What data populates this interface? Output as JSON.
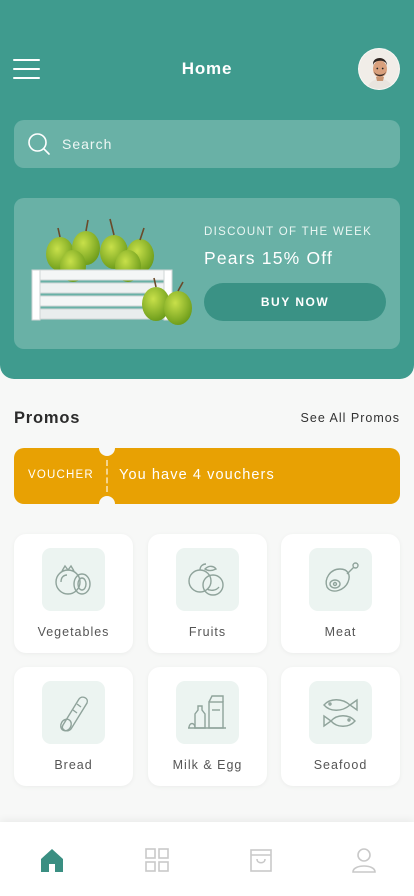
{
  "header": {
    "title": "Home"
  },
  "search": {
    "placeholder": "Search"
  },
  "promo_card": {
    "label": "DISCOUNT OF THE WEEK",
    "title": "Pears 15% Off",
    "button_label": "BUY NOW"
  },
  "promos": {
    "title": "Promos",
    "see_all_label": "See All Promos",
    "voucher_tag": "VOUCHER",
    "voucher_text": "You have 4 vouchers"
  },
  "categories": [
    {
      "label": "Vegetables",
      "icon": "vegetables-icon"
    },
    {
      "label": "Fruits",
      "icon": "fruits-icon"
    },
    {
      "label": "Meat",
      "icon": "meat-icon"
    },
    {
      "label": "Bread",
      "icon": "bread-icon"
    },
    {
      "label": "Milk & Egg",
      "icon": "milk-egg-icon"
    },
    {
      "label": "Seafood",
      "icon": "seafood-icon"
    }
  ],
  "tabs": [
    {
      "name": "home",
      "icon": "home-icon",
      "active": true
    },
    {
      "name": "categories",
      "icon": "grid-icon",
      "active": false
    },
    {
      "name": "cart",
      "icon": "bag-icon",
      "active": false
    },
    {
      "name": "profile",
      "icon": "user-icon",
      "active": false
    }
  ],
  "colors": {
    "primary": "#3f9b8e",
    "accent": "#e8a103",
    "tab_active": "#3a8f82",
    "tab_inactive": "#c9c9c9"
  }
}
